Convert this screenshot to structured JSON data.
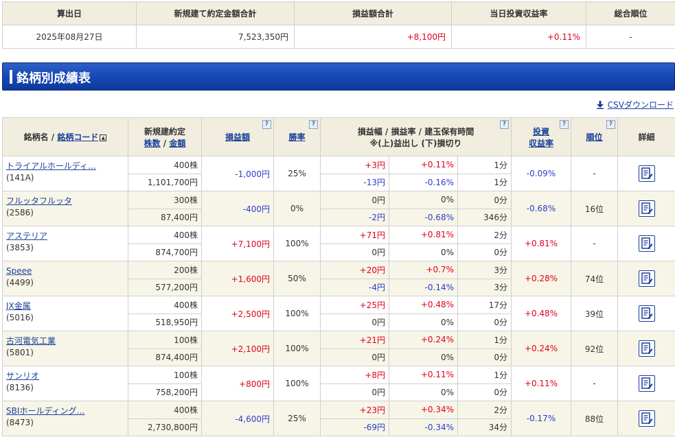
{
  "summary": {
    "headers": [
      "算出日",
      "新規建て約定金額合計",
      "損益額合計",
      "当日投資収益率",
      "総合順位"
    ],
    "date": "2025年08月27日",
    "total_amount": "7,523,350円",
    "total_pl": "+8,100円",
    "return_rate": "+0.11%",
    "rank": "-"
  },
  "section": {
    "title": "銘柄別成績表"
  },
  "csv_label": "CSVダウンロード",
  "table": {
    "h_name_a": "銘柄名 /",
    "h_name_b": "銘柄コード",
    "h_contract": "新規建約定",
    "h_shares": "株数",
    "h_sep": "/",
    "h_amount": "金額",
    "h_pl": "損益額",
    "h_winrate": "勝率",
    "h_range_1": "損益幅 / 損益率 / 建玉保有時間",
    "h_range_2": "※(上)益出し (下)損切り",
    "h_inv_1": "投資",
    "h_inv_2": "収益率",
    "h_rank": "順位",
    "h_detail": "詳細",
    "help": "?",
    "sort": "▲"
  },
  "rows": [
    {
      "name": "トライアルホールディ…",
      "code": "(141A)",
      "shares": "400株",
      "amount": "1,101,700円",
      "pl": "-1,000円",
      "pl_cls": "neg",
      "win": "25%",
      "up_w": "+3円",
      "up_w_cls": "pos",
      "up_r": "+0.11%",
      "up_r_cls": "pos",
      "up_t": "1分",
      "dn_w": "-13円",
      "dn_w_cls": "neg",
      "dn_r": "-0.16%",
      "dn_r_cls": "neg",
      "dn_t": "1分",
      "inv": "-0.09%",
      "inv_cls": "neg",
      "rank": "-"
    },
    {
      "name": "フルッタフルッタ",
      "code": "(2586)",
      "shares": "300株",
      "amount": "87,400円",
      "pl": "-400円",
      "pl_cls": "neg",
      "win": "0%",
      "up_w": "0円",
      "up_w_cls": "zero",
      "up_r": "0%",
      "up_r_cls": "zero",
      "up_t": "0分",
      "dn_w": "-2円",
      "dn_w_cls": "neg",
      "dn_r": "-0.68%",
      "dn_r_cls": "neg",
      "dn_t": "346分",
      "inv": "-0.68%",
      "inv_cls": "neg",
      "rank": "16位"
    },
    {
      "name": "アステリア",
      "code": "(3853)",
      "shares": "400株",
      "amount": "874,700円",
      "pl": "+7,100円",
      "pl_cls": "pos",
      "win": "100%",
      "up_w": "+71円",
      "up_w_cls": "pos",
      "up_r": "+0.81%",
      "up_r_cls": "pos",
      "up_t": "2分",
      "dn_w": "0円",
      "dn_w_cls": "zero",
      "dn_r": "0%",
      "dn_r_cls": "zero",
      "dn_t": "0分",
      "inv": "+0.81%",
      "inv_cls": "pos",
      "rank": "-"
    },
    {
      "name": "Speee",
      "code": "(4499)",
      "shares": "200株",
      "amount": "577,200円",
      "pl": "+1,600円",
      "pl_cls": "pos",
      "win": "50%",
      "up_w": "+20円",
      "up_w_cls": "pos",
      "up_r": "+0.7%",
      "up_r_cls": "pos",
      "up_t": "3分",
      "dn_w": "-4円",
      "dn_w_cls": "neg",
      "dn_r": "-0.14%",
      "dn_r_cls": "neg",
      "dn_t": "3分",
      "inv": "+0.28%",
      "inv_cls": "pos",
      "rank": "74位"
    },
    {
      "name": "JX金属",
      "code": "(5016)",
      "shares": "400株",
      "amount": "518,950円",
      "pl": "+2,500円",
      "pl_cls": "pos",
      "win": "100%",
      "up_w": "+25円",
      "up_w_cls": "pos",
      "up_r": "+0.48%",
      "up_r_cls": "pos",
      "up_t": "17分",
      "dn_w": "0円",
      "dn_w_cls": "zero",
      "dn_r": "0%",
      "dn_r_cls": "zero",
      "dn_t": "0分",
      "inv": "+0.48%",
      "inv_cls": "pos",
      "rank": "39位"
    },
    {
      "name": "古河電気工業",
      "code": "(5801)",
      "shares": "100株",
      "amount": "874,400円",
      "pl": "+2,100円",
      "pl_cls": "pos",
      "win": "100%",
      "up_w": "+21円",
      "up_w_cls": "pos",
      "up_r": "+0.24%",
      "up_r_cls": "pos",
      "up_t": "1分",
      "dn_w": "0円",
      "dn_w_cls": "zero",
      "dn_r": "0%",
      "dn_r_cls": "zero",
      "dn_t": "0分",
      "inv": "+0.24%",
      "inv_cls": "pos",
      "rank": "92位"
    },
    {
      "name": "サンリオ",
      "code": "(8136)",
      "shares": "100株",
      "amount": "758,200円",
      "pl": "+800円",
      "pl_cls": "pos",
      "win": "100%",
      "up_w": "+8円",
      "up_w_cls": "pos",
      "up_r": "+0.11%",
      "up_r_cls": "pos",
      "up_t": "1分",
      "dn_w": "0円",
      "dn_w_cls": "zero",
      "dn_r": "0%",
      "dn_r_cls": "zero",
      "dn_t": "0分",
      "inv": "+0.11%",
      "inv_cls": "pos",
      "rank": "-"
    },
    {
      "name": "SBIホールディング…",
      "code": "(8473)",
      "shares": "400株",
      "amount": "2,730,800円",
      "pl": "-4,600円",
      "pl_cls": "neg",
      "win": "25%",
      "up_w": "+23円",
      "up_w_cls": "pos",
      "up_r": "+0.34%",
      "up_r_cls": "pos",
      "up_t": "2分",
      "dn_w": "-69円",
      "dn_w_cls": "neg",
      "dn_r": "-0.34%",
      "dn_r_cls": "neg",
      "dn_t": "34分",
      "inv": "-0.17%",
      "inv_cls": "neg",
      "rank": "88位"
    }
  ],
  "colors": {
    "header_bg": "#f2eedf",
    "alt_bg": "#f7f5e8",
    "positive": "#e0001b",
    "negative": "#2b3ccc",
    "section_blue": "#1848b2",
    "link": "#1a3f9a"
  },
  "icons": {
    "detail": "detail-document-icon",
    "download": "download-arrow-icon",
    "help": "help-icon",
    "sort": "sort-ascending-icon"
  }
}
